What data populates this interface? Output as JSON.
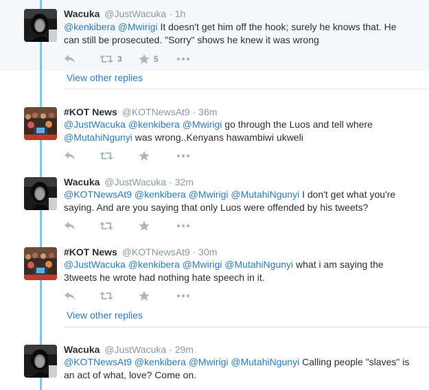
{
  "colors": {
    "link": "#2b7bb9",
    "thread_line": "#7fc6e8",
    "meta": "#8899a6",
    "icon": "#aab8c2"
  },
  "tweets": [
    {
      "name": "Wacuka",
      "handle": "@JustWacuka",
      "dot": "·",
      "time": "1h",
      "parts": [
        {
          "text": "@kenkibera",
          "mention": true
        },
        {
          "text": " ",
          "mention": false
        },
        {
          "text": "@Mwirigi",
          "mention": true
        },
        {
          "text": " It doesn't get him off the hook; surely he knows that. He can still be prosecuted. \"Sorry\" shows he knew it was wrong",
          "mention": false
        }
      ],
      "retweets": "3",
      "favorites": "5",
      "more": "•••"
    },
    {
      "name": "#KOT News",
      "handle": "@KOTNewsAt9",
      "dot": "·",
      "time": "36m",
      "parts": [
        {
          "text": "@JustWacuka",
          "mention": true
        },
        {
          "text": " ",
          "mention": false
        },
        {
          "text": "@kenkibera",
          "mention": true
        },
        {
          "text": " ",
          "mention": false
        },
        {
          "text": "@Mwirigi",
          "mention": true
        },
        {
          "text": " go through the Luos and tell where ",
          "mention": false
        },
        {
          "text": "@MutahiNgunyi",
          "mention": true
        },
        {
          "text": " was wrong..Kenyans hawambiwi ukweli",
          "mention": false
        }
      ],
      "retweets": "",
      "favorites": "",
      "more": "•••"
    },
    {
      "name": "Wacuka",
      "handle": "@JustWacuka",
      "dot": "·",
      "time": "32m",
      "parts": [
        {
          "text": "@KOTNewsAt9",
          "mention": true
        },
        {
          "text": " ",
          "mention": false
        },
        {
          "text": "@kenkibera",
          "mention": true
        },
        {
          "text": " ",
          "mention": false
        },
        {
          "text": "@Mwirigi",
          "mention": true
        },
        {
          "text": " ",
          "mention": false
        },
        {
          "text": "@MutahiNgunyi",
          "mention": true
        },
        {
          "text": " I don't get what you're saying. And are you saying that only Luos were offended by his tweets?",
          "mention": false
        }
      ],
      "retweets": "",
      "favorites": "",
      "more": "•••"
    },
    {
      "name": "#KOT News",
      "handle": "@KOTNewsAt9",
      "dot": "·",
      "time": "30m",
      "parts": [
        {
          "text": "@JustWacuka",
          "mention": true
        },
        {
          "text": " ",
          "mention": false
        },
        {
          "text": "@kenkibera",
          "mention": true
        },
        {
          "text": " ",
          "mention": false
        },
        {
          "text": "@Mwirigi",
          "mention": true
        },
        {
          "text": " ",
          "mention": false
        },
        {
          "text": "@MutahiNgunyi",
          "mention": true
        },
        {
          "text": " what i am saying the 3tweets he wrote had nothing hate speech in it.",
          "mention": false
        }
      ],
      "retweets": "",
      "favorites": "",
      "more": "•••"
    },
    {
      "name": "Wacuka",
      "handle": "@JustWacuka",
      "dot": "·",
      "time": "29m",
      "parts": [
        {
          "text": "@KOTNewsAt9",
          "mention": true
        },
        {
          "text": " ",
          "mention": false
        },
        {
          "text": "@kenkibera",
          "mention": true
        },
        {
          "text": " ",
          "mention": false
        },
        {
          "text": "@Mwirigi",
          "mention": true
        },
        {
          "text": " ",
          "mention": false
        },
        {
          "text": "@MutahiNgunyi",
          "mention": true
        },
        {
          "text": " Calling people \"slaves\" is an act of what, love? Come on.",
          "mention": false
        }
      ],
      "retweets": "",
      "favorites": "",
      "more": "•••"
    }
  ],
  "view_other_replies": "View other replies"
}
